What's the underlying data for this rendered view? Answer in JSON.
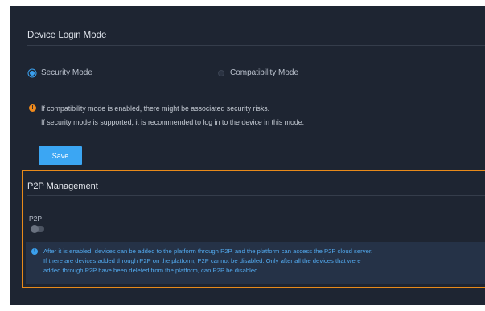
{
  "login_mode": {
    "title": "Device Login Mode",
    "options": [
      {
        "label": "Security Mode",
        "selected": true
      },
      {
        "label": "Compatibility Mode",
        "selected": false
      }
    ],
    "warning_lines": [
      "If compatibility mode is enabled, there might be associated security risks.",
      "If security mode is supported, it is recommended to log in to the device in this mode."
    ],
    "save_label": "Save"
  },
  "p2p": {
    "title": "P2P Management",
    "toggle_label": "P2P",
    "enabled": false,
    "info_lines": [
      "After it is enabled, devices can be added to the platform through P2P, and the platform can access the P2P cloud server.",
      "If there are devices added through P2P on the platform, P2P cannot be disabled. Only after all the devices that were",
      "added through P2P have been deleted from the platform, can P2P be disabled."
    ]
  },
  "colors": {
    "accent": "#3ba6f3",
    "warning": "#f08a1c",
    "highlight_border": "#e88a1a",
    "panel_bg": "#1e2532"
  }
}
